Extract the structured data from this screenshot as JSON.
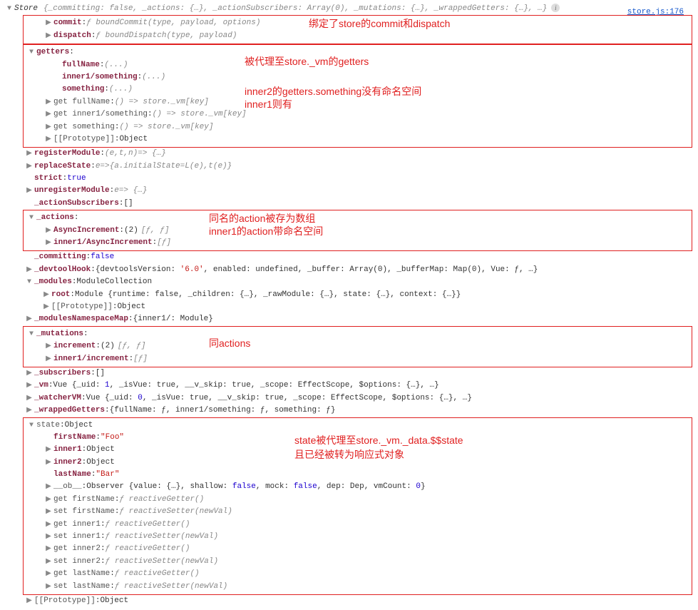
{
  "source_link": "store.js:176",
  "root": {
    "ctor": "Store",
    "preview": "{_committing: false, _actions: {…}, _actionSubscribers: Array(0), _mutations: {…}, _wrappedGetters: {…}, …}"
  },
  "box1": {
    "ann": "绑定了store的commit和dispatch",
    "commit": {
      "key": "commit",
      "val": "ƒ boundCommit(type, payload, options)"
    },
    "dispatch": {
      "key": "dispatch",
      "val": "ƒ boundDispatch(type, payload)"
    }
  },
  "box2": {
    "ann1": "被代理至store._vm的getters",
    "ann2": "inner2的getters.something没有命名空间",
    "ann3": "inner1则有",
    "getters": "getters",
    "g1": {
      "key": "fullName",
      "val": "(...)"
    },
    "g2": {
      "key": "inner1/something",
      "val": "(...)"
    },
    "g3": {
      "key": "something",
      "val": "(...)"
    },
    "ga1": {
      "key": "get fullName",
      "val": "() => store._vm[key]"
    },
    "ga2": {
      "key": "get inner1/something",
      "val": "() => store._vm[key]"
    },
    "ga3": {
      "key": "get something",
      "val": "() => store._vm[key]"
    },
    "proto": {
      "key": "[[Prototype]]",
      "val": "Object"
    }
  },
  "mid": {
    "registerModule": {
      "key": "registerModule",
      "val": "(e,t,n)=> {…}"
    },
    "replaceState": {
      "key": "replaceState",
      "val": "e=>{a.initialState=L(e),t(e)}"
    },
    "strict": {
      "key": "strict",
      "val": "true"
    },
    "unregisterModule": {
      "key": "unregisterModule",
      "val": "e=> {…}"
    },
    "actionSubscribers": {
      "key": "_actionSubscribers",
      "val": "[]"
    }
  },
  "box3": {
    "ann1": "同名的action被存为数组",
    "ann2": "inner1的action带命名空间",
    "actions": "_actions",
    "a1": {
      "key": "AsyncIncrement",
      "count": "(2)",
      "val": "[ƒ, ƒ]"
    },
    "a2": {
      "key": "inner1/AsyncIncrement",
      "val": "[ƒ]"
    }
  },
  "mid2": {
    "committing": {
      "key": "_committing",
      "val": "false"
    },
    "devtoolHook": {
      "key": "_devtoolHook",
      "val_pre": "{devtoolsVersion: ",
      "ver": "'6.0'",
      "val_post": ", enabled: undefined, _buffer: Array(0), _bufferMap: Map(0), Vue: ƒ, …}"
    },
    "modules": {
      "key": "_modules",
      "val": "ModuleCollection"
    },
    "root": {
      "key": "root",
      "val": "Module  {runtime: false, _children: {…}, _rawModule: {…}, state: {…}, context: {…}}"
    },
    "proto": {
      "key": "[[Prototype]]",
      "val": "Object"
    },
    "modulesNamespaceMap": {
      "key": "_modulesNamespaceMap",
      "val": "{inner1/: Module}"
    }
  },
  "box4": {
    "ann": "同actions",
    "mutations": "_mutations",
    "m1": {
      "key": "increment",
      "count": "(2)",
      "val": "[ƒ, ƒ]"
    },
    "m2": {
      "key": "inner1/increment",
      "val": "[ƒ]"
    }
  },
  "mid3": {
    "subscribers": {
      "key": "_subscribers",
      "val": "[]"
    },
    "vm": {
      "key": "_vm",
      "pre": "Vue  {_uid: ",
      "uid": "1",
      "post": ", _isVue: true, __v_skip: true, _scope: EffectScope, $options: {…}, …}"
    },
    "watcherVM": {
      "key": "_watcherVM",
      "pre": "Vue  {_uid: ",
      "uid": "0",
      "post": ", _isVue: true, __v_skip: true, _scope: EffectScope, $options: {…}, …}"
    },
    "wrappedGetters": {
      "key": "_wrappedGetters",
      "val": "{fullName: ƒ, inner1/something: ƒ, something: ƒ}"
    }
  },
  "box5": {
    "ann1": "state被代理至store._vm._data.$$state",
    "ann2": "且已经被转为响应式对象",
    "state": {
      "key": "state",
      "val": "Object"
    },
    "firstName": {
      "key": "firstName",
      "val": "\"Foo\""
    },
    "inner1": {
      "key": "inner1",
      "val": "Object"
    },
    "inner2": {
      "key": "inner2",
      "val": "Object"
    },
    "lastName": {
      "key": "lastName",
      "val": "\"Bar\""
    },
    "ob": {
      "key": "__ob__",
      "pre": "Observer  {value: {…}, shallow: ",
      "f1": "false",
      "m": ", mock: ",
      "f2": "false",
      "d": ", dep: Dep, vmCount: ",
      "vc": "0",
      "end": "}"
    },
    "accessors": [
      {
        "key": "get firstName",
        "val": "ƒ reactiveGetter()"
      },
      {
        "key": "set firstName",
        "val": "ƒ reactiveSetter(newVal)"
      },
      {
        "key": "get inner1",
        "val": "ƒ reactiveGetter()"
      },
      {
        "key": "set inner1",
        "val": "ƒ reactiveSetter(newVal)"
      },
      {
        "key": "get inner2",
        "val": "ƒ reactiveGetter()"
      },
      {
        "key": "set inner2",
        "val": "ƒ reactiveSetter(newVal)"
      },
      {
        "key": "get lastName",
        "val": "ƒ reactiveGetter()"
      },
      {
        "key": "set lastName",
        "val": "ƒ reactiveSetter(newVal)"
      }
    ]
  },
  "foot": {
    "proto": {
      "key": "[[Prototype]]",
      "val": "Object"
    }
  }
}
